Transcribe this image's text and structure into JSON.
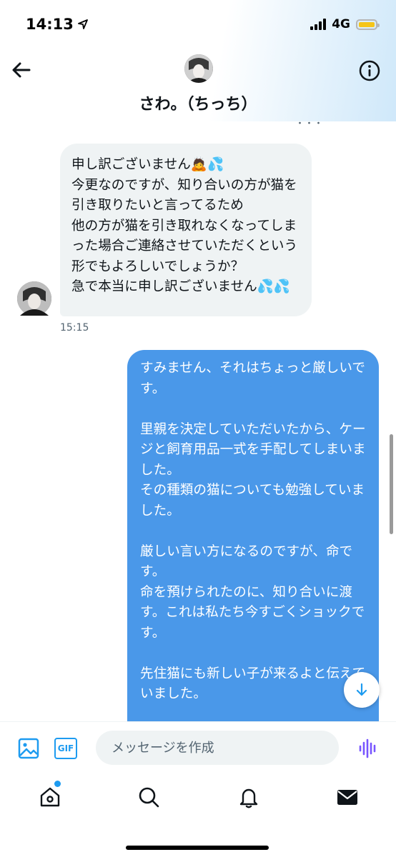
{
  "status_bar": {
    "time": "14:13",
    "network": "4G",
    "battery_level": 0.9,
    "battery_color": "#f5c518"
  },
  "header": {
    "title": "さわ。（ちっち）",
    "back_icon": "arrow-left-icon",
    "info_icon": "info-icon"
  },
  "messages": {
    "truncated_above": "・・・",
    "incoming": {
      "text": "申し訳ございません🙇💦\n今更なのですが、知り合いの方が猫を引き取りたいと言ってるため\n他の方が猫を引き取れなくなってしまった場合ご連絡させていただくという形でもよろしいでしょうか？\n急で本当に申し訳ございません💦💦",
      "time": "15:15"
    },
    "outgoing": {
      "text": "すみません、それはちょっと厳しいです。\n\n里親を決定していただいたから、ケージと飼育用品一式を手配してしまいました。\nその種類の猫についても勉強していました。\n\n厳しい言い方になるのですが、命です。\n命を預けられたのに、知り合いに渡す。これは私たち今すごくショックです。\n\n先住猫にも新しい子が来るよと伝えていました。\n\nそれなら、最終決定まで里親の締め"
    }
  },
  "composer": {
    "placeholder": "メッセージを作成",
    "gif_label": "GIF",
    "accent_color": "#1d9bf0",
    "voice_color": "#7856ff"
  },
  "tabbar": {
    "items": [
      "home-icon",
      "search-icon",
      "bell-icon",
      "envelope-icon"
    ],
    "active": "envelope-icon",
    "home_has_notification": true
  },
  "colors": {
    "outgoing_bubble": "#4a98e9",
    "incoming_bubble": "#eff3f4"
  }
}
